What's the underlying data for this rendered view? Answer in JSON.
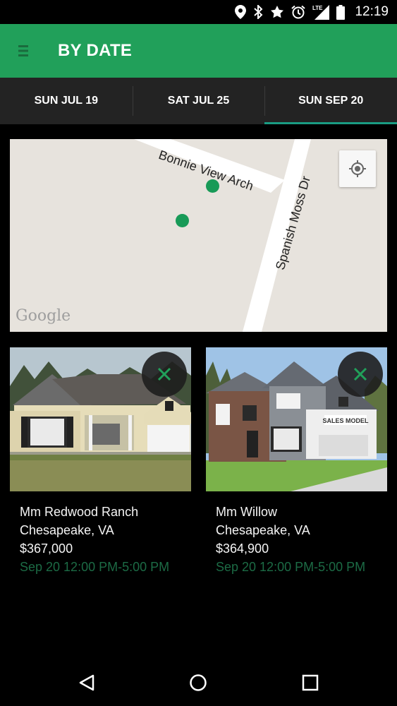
{
  "status_bar": {
    "time": "12:19",
    "icons": [
      "location-icon",
      "bluetooth-icon",
      "star-icon",
      "alarm-icon",
      "lte-signal-icon",
      "battery-icon"
    ],
    "network_label": "LTE"
  },
  "app_bar": {
    "title": "BY DATE",
    "menu_icon": "menu-icon",
    "background": "#21a05a"
  },
  "tabs": [
    {
      "label": "SUN JUL 19",
      "active": false
    },
    {
      "label": "SAT JUL 25",
      "active": false
    },
    {
      "label": "SUN SEP 20",
      "active": true
    }
  ],
  "map": {
    "roads": [
      {
        "label": "Bonnie View Arch"
      },
      {
        "label": "Spanish Moss Dr"
      }
    ],
    "attribution": "Google",
    "locate_icon": "my-location-icon",
    "marker_color": "#189a57"
  },
  "listings": [
    {
      "name": "Mm Redwood Ranch",
      "city": "Chesapeake, VA",
      "price": "$367,000",
      "time": "Sep 20 12:00 PM-5:00 PM"
    },
    {
      "name": "Mm Willow",
      "city": "Chesapeake, VA",
      "price": "$364,900",
      "time": "Sep 20 12:00 PM-5:00 PM",
      "photo_sign": "SALES MODEL"
    }
  ],
  "nav_bar": {
    "buttons": [
      "back-icon",
      "home-icon",
      "recents-icon"
    ]
  }
}
